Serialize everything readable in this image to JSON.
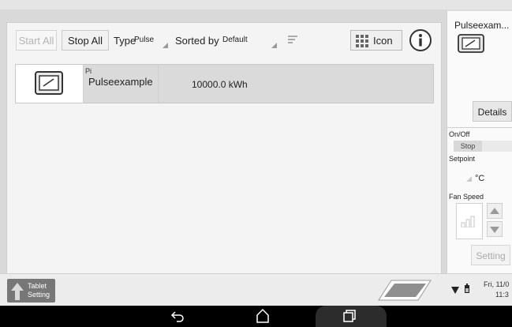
{
  "toolbar": {
    "start_all": "Start All",
    "stop_all": "Stop All",
    "type_label": "Type",
    "type_value": "Pulse",
    "sorted_by_label": "Sorted by",
    "sorted_by_value": "Default",
    "icon_button": "Icon"
  },
  "device_row": {
    "type_code": "Pi",
    "name": "Pulseexample",
    "value": "10000.0 kWh"
  },
  "detail_panel": {
    "title": "Pulseexam...",
    "details_button": "Details",
    "onoff_label": "On/Off",
    "stop_button": "Stop",
    "setpoint_label": "Setpoint",
    "setpoint_unit": "°C",
    "fan_speed_label": "Fan Speed",
    "setting_button": "Setting"
  },
  "bottom": {
    "tablet_setting": [
      "Tablet",
      "Setting"
    ],
    "clock_date": "Fri, 11/0",
    "clock_time": "11:3"
  },
  "colors": {
    "accent": "#7a7a7a",
    "row_bg": "#dadada",
    "panel_bg": "#f4f4f4"
  }
}
